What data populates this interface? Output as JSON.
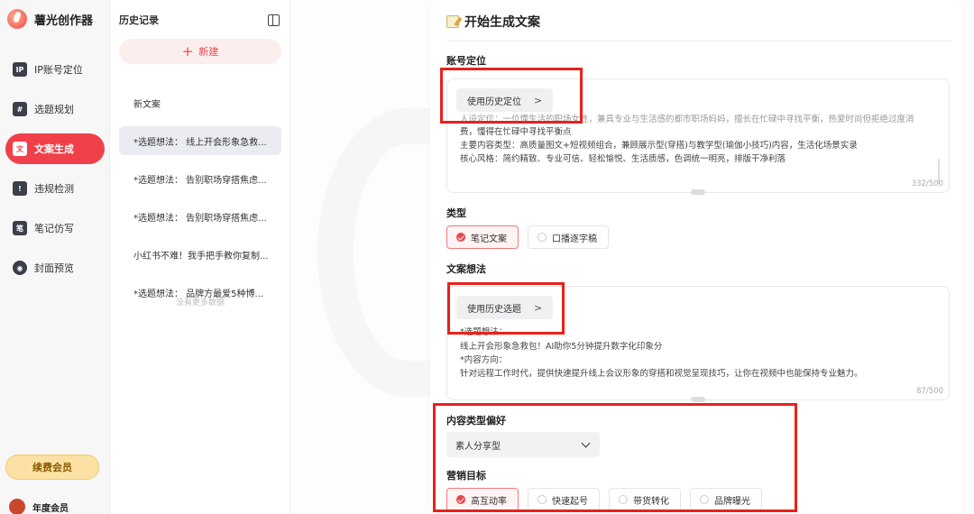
{
  "app": {
    "name": "薯光创作器"
  },
  "sidebar": {
    "items": [
      {
        "label": "IP账号定位",
        "icon": "IP",
        "active": false
      },
      {
        "label": "选题规划",
        "icon": "#",
        "active": false
      },
      {
        "label": "文案生成",
        "icon": "文",
        "active": true
      },
      {
        "label": "违规检测",
        "icon": "!",
        "active": false
      },
      {
        "label": "笔记仿写",
        "icon": "笔",
        "active": false
      },
      {
        "label": "封面预览",
        "icon": "◉",
        "active": false
      }
    ],
    "vip_button": "续费会员",
    "user_label": "年度会员"
  },
  "history": {
    "title": "历史记录",
    "new_button": "新建",
    "items": [
      "新文案",
      "*选题想法： 线上开会形象急救...",
      "*选题想法： 告别职场穿搭焦虑...",
      "*选题想法： 告别职场穿搭焦虑...",
      "小红书不难！我手把手教你复制...",
      "*选题想法： 品牌方最爱5种博..."
    ],
    "active_index": 1,
    "no_more": "没有更多数据"
  },
  "main": {
    "title": "开始生成文案",
    "account_position": {
      "label": "账号定位",
      "history_button": "使用历史定位",
      "lines": [
        "人设定位：一位懂生活的职场女性，兼具专业与生活感的都市职场妈妈，擅长在忙碌中寻找平衡，热爱时尚但拒绝过度消",
        "费，懂得在忙碌中寻找平衡点",
        "主要内容类型：高质量图文+短视频组合，兼顾展示型(穿搭)与教学型(瑜伽小技巧)内容，生活化场景实录",
        "核心风格：简约精致、专业可信、轻松愉悦、生活质感，色调统一明亮，排版干净利落"
      ],
      "counter": "332/500"
    },
    "type": {
      "label": "类型",
      "options": [
        {
          "label": "笔记文案",
          "selected": true
        },
        {
          "label": "口播逐字稿",
          "selected": false
        }
      ]
    },
    "copy_idea": {
      "label": "文案想法",
      "history_button": "使用历史选题",
      "lines": [
        "*选题想法：",
        "线上开会形象急救包！AI助你5分钟提升数字化印象分",
        "*内容方向：",
        "针对远程工作时代，提供快速提升线上会议形象的穿搭和视觉呈现技巧，让你在视频中也能保持专业魅力。"
      ],
      "counter": "87/500"
    },
    "content_preference": {
      "label": "内容类型偏好",
      "value": "素人分享型"
    },
    "marketing_goal": {
      "label": "营销目标",
      "options": [
        {
          "label": "高互动率",
          "selected": true
        },
        {
          "label": "快速起号",
          "selected": false
        },
        {
          "label": "带货转化",
          "selected": false
        },
        {
          "label": "品牌曝光",
          "selected": false
        }
      ]
    }
  },
  "colors": {
    "accent": "#f0404a",
    "highlight": "#e8221b",
    "vip": "#fbe2a4"
  }
}
